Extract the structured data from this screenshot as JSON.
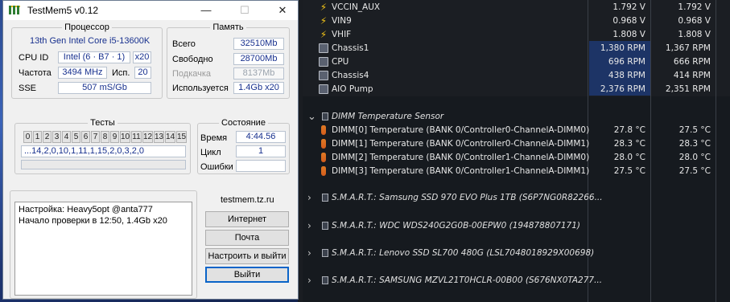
{
  "window": {
    "title": "TestMem5 v0.12",
    "minimize": "—",
    "maximize": "☐",
    "close": "✕"
  },
  "cpu": {
    "legend": "Процессор",
    "name": "13th Gen Intel Core i5-13600K",
    "cpuid_label": "CPU ID",
    "cpuid_value": "Intel  (6 · B7 · 1)",
    "threads": "x20",
    "freq_label": "Частота",
    "freq_value": "3494 MHz",
    "used_label": "Исп.",
    "used_value": "20",
    "sse_label": "SSE",
    "sse_value": "507 mS/Gb"
  },
  "memory": {
    "legend": "Память",
    "total_label": "Всего",
    "total_value": "32510Mb",
    "free_label": "Свободно",
    "free_value": "28700Mb",
    "swap_label": "Подкачка",
    "swap_value": "8137Mb",
    "used_label": "Используется",
    "used_value": "1.4Gb x20"
  },
  "tests": {
    "legend": "Тесты",
    "boxes": [
      "0",
      "1",
      "2",
      "3",
      "4",
      "5",
      "6",
      "7",
      "8",
      "9",
      "10",
      "11",
      "12",
      "13",
      "14",
      "15"
    ],
    "sequence": "...14,2,0,10,1,11,1,15,2,0,3,2,0"
  },
  "status": {
    "legend": "Состояние",
    "time_label": "Время",
    "time_value": "4:44.56",
    "cycle_label": "Цикл",
    "cycle_value": "1",
    "errors_label": "Ошибки",
    "errors_value": ""
  },
  "log": {
    "line1": "Настройка: Heavy5opt @anta777",
    "line2": "Начало проверки в 12:50, 1.4Gb x20"
  },
  "links": {
    "site": "testmem.tz.ru",
    "internet": "Интернет",
    "mail": "Почта",
    "configure_exit": "Настроить и выйти",
    "exit": "Выйти"
  },
  "sensors": {
    "voltages": [
      {
        "name": "VCCIN_AUX",
        "current": "1.792 V",
        "min": "1.792 V",
        "icon": "lightning-icon"
      },
      {
        "name": "VIN9",
        "current": "0.968 V",
        "min": "0.968 V",
        "icon": "lightning-icon"
      },
      {
        "name": "VHIF",
        "current": "1.808 V",
        "min": "1.808 V",
        "icon": "lightning-icon"
      }
    ],
    "fans": [
      {
        "name": "Chassis1",
        "current": "1,380 RPM",
        "min": "1,367 RPM",
        "icon": "fan-icon"
      },
      {
        "name": "CPU",
        "current": "696 RPM",
        "min": "666 RPM",
        "icon": "fan-icon"
      },
      {
        "name": "Chassis4",
        "current": "438 RPM",
        "min": "414 RPM",
        "icon": "fan-icon"
      },
      {
        "name": "AIO Pump",
        "current": "2,376 RPM",
        "min": "2,351 RPM",
        "icon": "fan-icon"
      }
    ],
    "dimm_section": "DIMM Temperature Sensor",
    "dimms": [
      {
        "name": "DIMM[0] Temperature (BANK 0/Controller0-ChannelA-DIMM0)",
        "current": "27.8 °C",
        "min": "27.5 °C"
      },
      {
        "name": "DIMM[1] Temperature (BANK 0/Controller0-ChannelA-DIMM1)",
        "current": "28.3 °C",
        "min": "28.3 °C"
      },
      {
        "name": "DIMM[2] Temperature (BANK 0/Controller1-ChannelA-DIMM0)",
        "current": "28.0 °C",
        "min": "28.0 °C"
      },
      {
        "name": "DIMM[3] Temperature (BANK 0/Controller1-ChannelA-DIMM1)",
        "current": "27.5 °C",
        "min": "27.5 °C"
      }
    ],
    "smart": [
      "S.M.A.R.T.: Samsung SSD 970 EVO Plus 1TB (S6P7NG0R82266...",
      "S.M.A.R.T.: WDC WDS240G2G0B-00EPW0 (194878807171)",
      "S.M.A.R.T.: Lenovo SSD SL700 480G (LSL7048018929X00698)",
      "S.M.A.R.T.: SAMSUNG MZVL21T0HCLR-00B00 (S676NX0TA277..."
    ]
  },
  "colors": {
    "value_text": "#17308e",
    "fan_highlight": "#1d3466",
    "bolt": "#f5c518",
    "thermometer": "#e07a24"
  }
}
